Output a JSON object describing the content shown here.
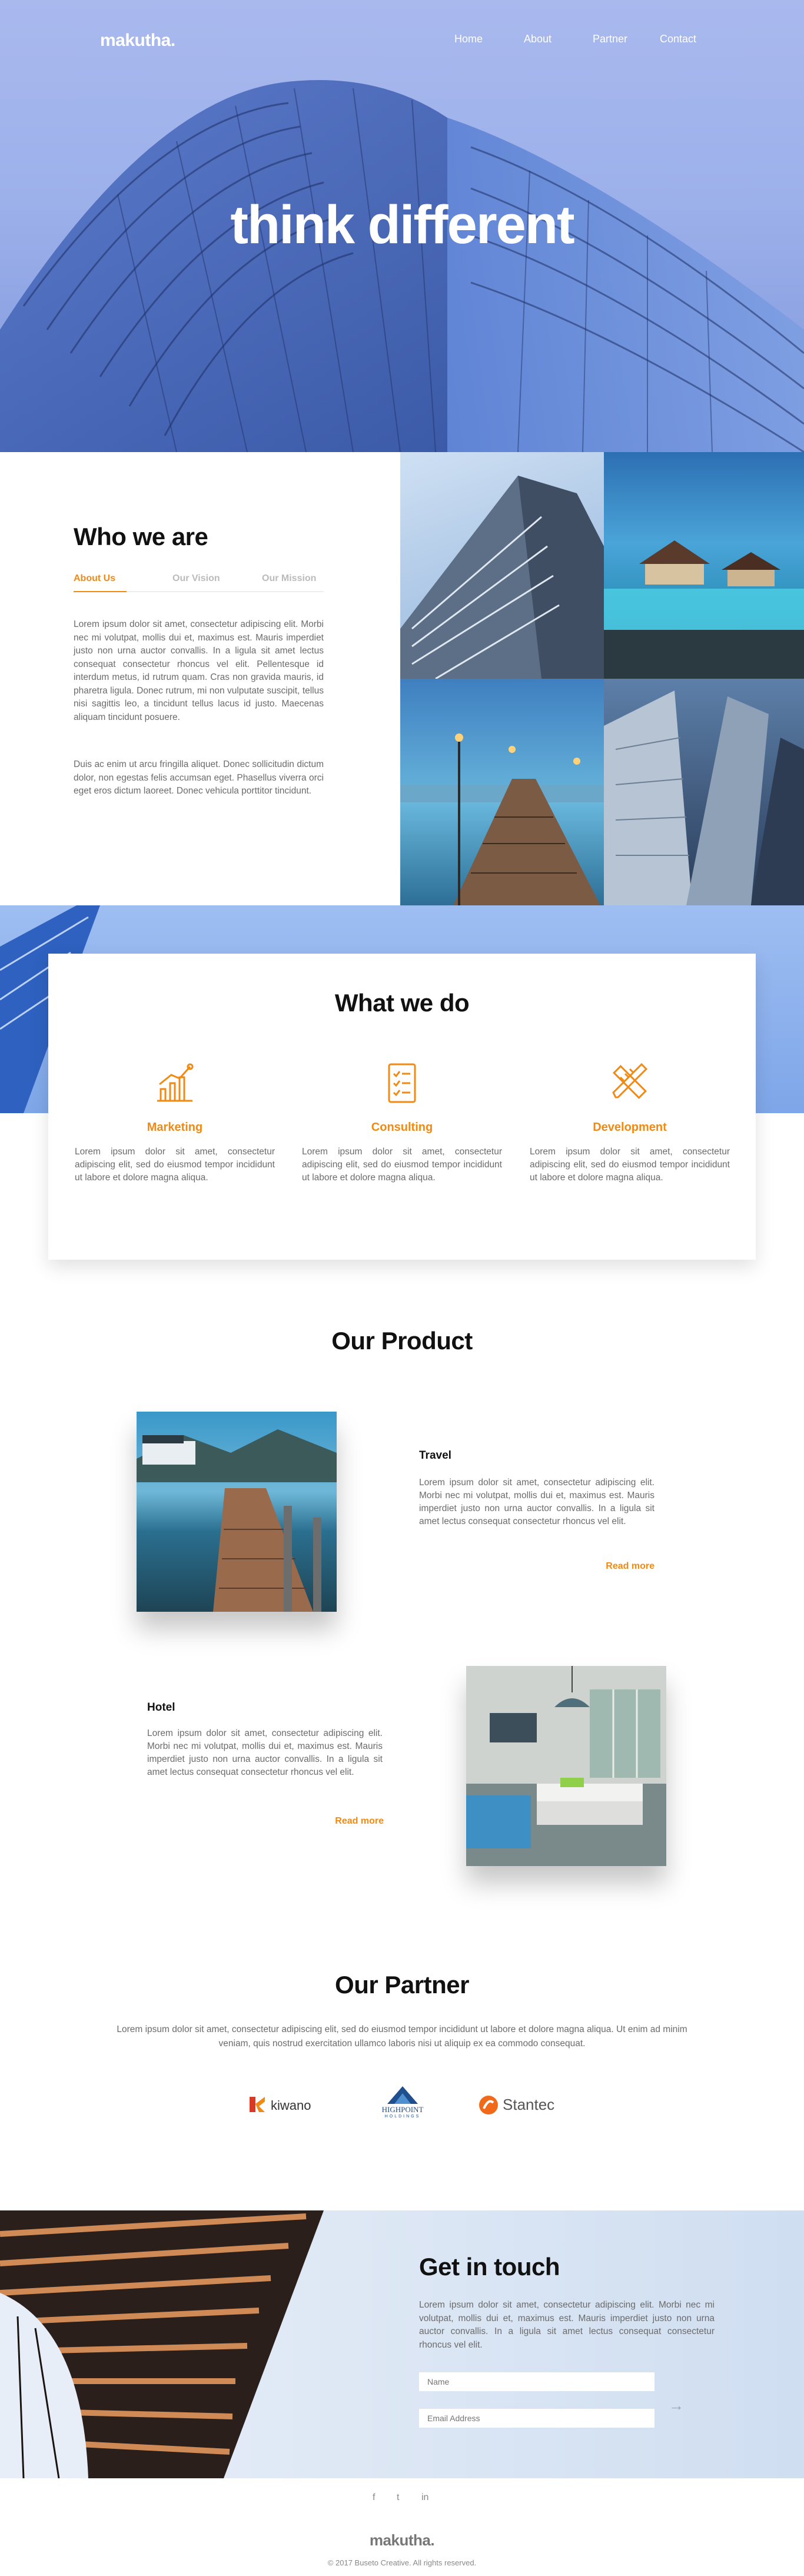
{
  "header": {
    "logo": "makutha.",
    "nav": [
      "Home",
      "About",
      "Partner",
      "Contact"
    ],
    "headline": "think different"
  },
  "who": {
    "title": "Who we are",
    "tabs": [
      "About Us",
      "Our Vision",
      "Our Mission"
    ],
    "active_tab": "About Us",
    "paragraph1": "Lorem ipsum dolor sit amet, consectetur adipiscing elit. Morbi nec mi volutpat, mollis dui et, maximus est. Mauris imperdiet justo non urna auctor convallis. In a ligula sit amet lectus consequat consectetur rhoncus vel elit. Pellentesque id interdum metus, id rutrum quam. Cras non gravida mauris, id pharetra ligula. Donec rutrum, mi non vulputate suscipit, tellus nisi sagittis leo, a tincidunt tellus lacus id justo. Maecenas aliquam tincidunt posuere.",
    "paragraph2": "Duis ac enim ut arcu fringilla aliquet. Donec sollicitudin dictum dolor, non egestas felis accumsan eget. Phasellus viverra orci eget eros dictum laoreet. Donec vehicula porttitor tincidunt."
  },
  "what": {
    "title": "What we do",
    "services": [
      {
        "title": "Marketing",
        "icon": "chart-icon",
        "text": "Lorem ipsum dolor sit amet, consectetur adipiscing elit, sed do eiusmod tempor incididunt ut labore et dolore magna aliqua."
      },
      {
        "title": "Consulting",
        "icon": "checklist-icon",
        "text": "Lorem ipsum dolor sit amet, consectetur adipiscing elit, sed do eiusmod tempor incididunt ut labore et dolore magna aliqua."
      },
      {
        "title": "Development",
        "icon": "pencil-ruler-icon",
        "text": "Lorem ipsum dolor sit amet, consectetur adipiscing elit, sed do eiusmod tempor incididunt ut labore et dolore magna aliqua."
      }
    ]
  },
  "product": {
    "title": "Our Product",
    "items": [
      {
        "title": "Travel",
        "text": "Lorem ipsum dolor sit amet, consectetur adipiscing elit. Morbi nec mi volutpat, mollis dui et, maximus est. Mauris imperdiet justo non urna auctor convallis. In a ligula sit amet lectus consequat consectetur rhoncus vel elit.",
        "more": "Read more"
      },
      {
        "title": "Hotel",
        "text": "Lorem ipsum dolor sit amet, consectetur adipiscing elit. Morbi nec mi volutpat, mollis dui et, maximus est. Mauris imperdiet justo non urna auctor convallis. In a ligula sit amet lectus consequat consectetur rhoncus vel elit.",
        "more": "Read more"
      }
    ]
  },
  "partner": {
    "title": "Our Partner",
    "text": "Lorem ipsum dolor sit amet, consectetur adipiscing elit, sed do eiusmod tempor incididunt ut labore et dolore magna aliqua. Ut enim ad minim veniam, quis nostrud exercitation ullamco laboris nisi ut aliquip ex ea commodo consequat.",
    "logos": [
      "kiwano",
      "HIGHPOINT",
      "Stantec"
    ],
    "highpoint_sub": "HOLDINGS"
  },
  "contact": {
    "title": "Get in touch",
    "text": "Lorem ipsum dolor sit amet, consectetur adipiscing elit. Morbi nec mi volutpat, mollis dui et, maximus est. Mauris imperdiet justo non urna auctor convallis. In a ligula sit amet lectus consequat consectetur rhoncus vel elit.",
    "name_placeholder": "Name",
    "email_placeholder": "Email Address",
    "send_arrow": "→"
  },
  "footer": {
    "social": [
      "f",
      "t",
      "in"
    ],
    "logo": "makutha.",
    "copyright": "© 2017 Buseto Creative. All rights reserved."
  },
  "colors": {
    "accent": "#f08a12",
    "text_muted": "#6b6b6b",
    "sky": "#9cb0ea"
  }
}
